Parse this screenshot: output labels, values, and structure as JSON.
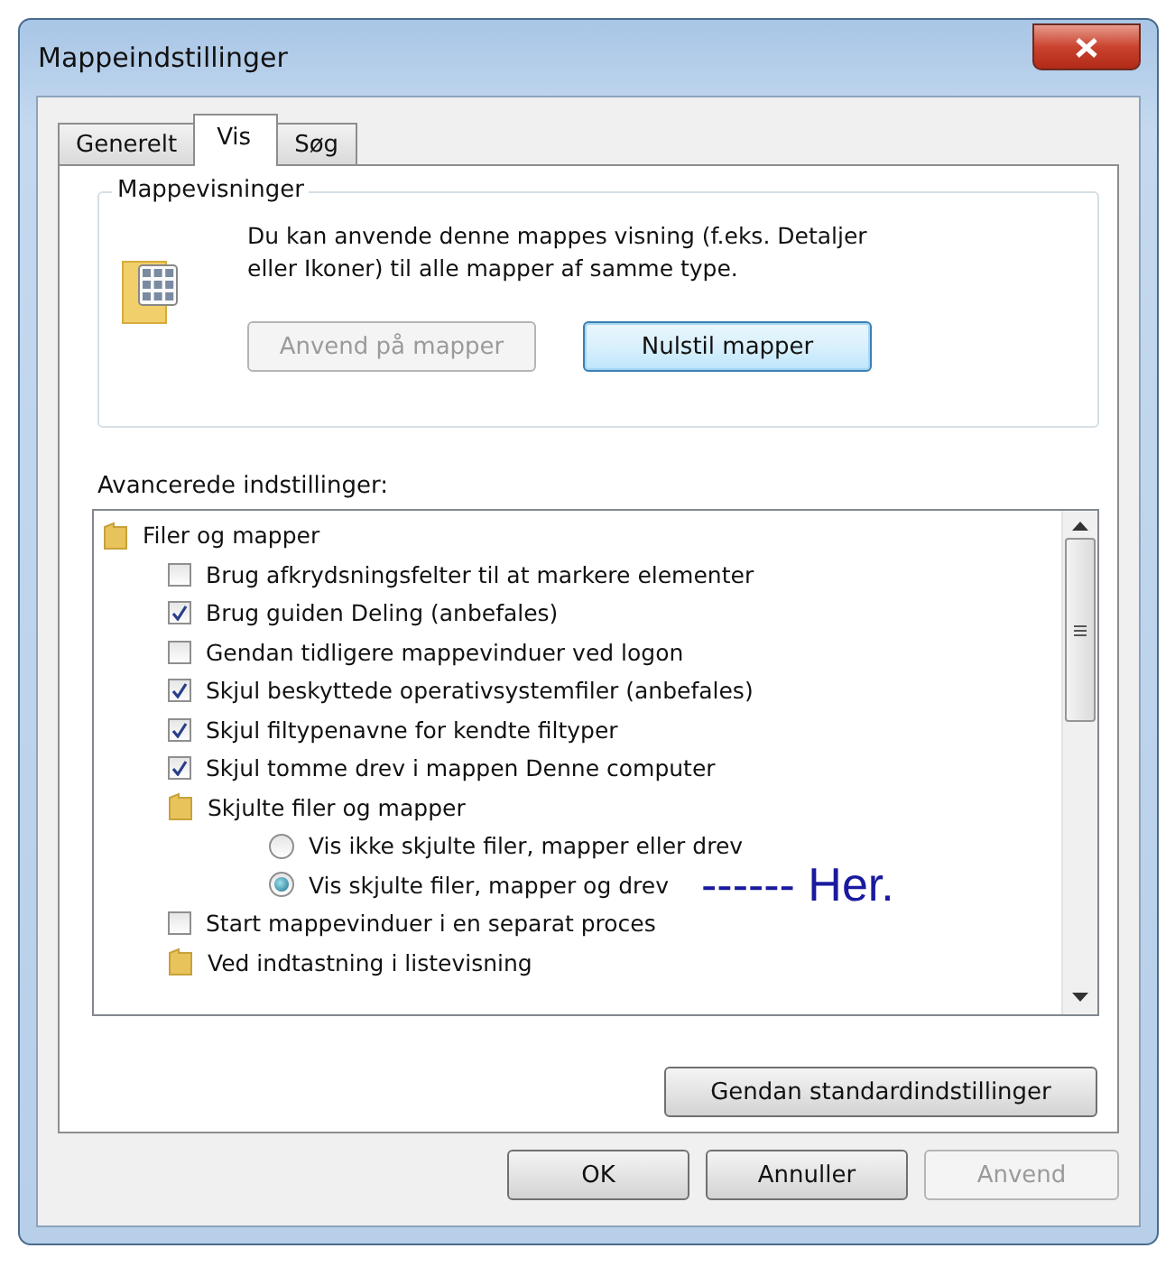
{
  "window": {
    "title": "Mappeindstillinger"
  },
  "tabs": [
    {
      "label": "Generelt",
      "selected": false
    },
    {
      "label": "Vis",
      "selected": true
    },
    {
      "label": "Søg",
      "selected": false
    }
  ],
  "folder_views": {
    "title": "Mappevisninger",
    "description": "Du kan anvende denne mappes visning (f.eks. Detaljer eller Ikoner) til alle mapper af samme type.",
    "buttons": [
      {
        "label": "Anvend på mapper",
        "disabled": true,
        "default": false
      },
      {
        "label": "Nulstil mapper",
        "disabled": false,
        "default": true
      }
    ]
  },
  "advanced": {
    "label": "Avancerede indstillinger:",
    "items": [
      {
        "kind": "folder",
        "label": "Filer og mapper",
        "children": [
          {
            "kind": "checkbox",
            "label": "Brug afkrydsningsfelter til at markere elementer",
            "checked": false
          },
          {
            "kind": "checkbox",
            "label": "Brug guiden Deling (anbefales)",
            "checked": true
          },
          {
            "kind": "checkbox",
            "label": "Gendan tidligere mappevinduer ved logon",
            "checked": false
          },
          {
            "kind": "checkbox",
            "label": "Skjul beskyttede operativsystemfiler (anbefales)",
            "checked": true
          },
          {
            "kind": "checkbox",
            "label": "Skjul filtypenavne for kendte filtyper",
            "checked": true
          },
          {
            "kind": "checkbox",
            "label": "Skjul tomme drev i mappen Denne computer",
            "checked": true
          },
          {
            "kind": "folder",
            "label": "Skjulte filer og mapper",
            "children": [
              {
                "kind": "radio",
                "label": "Vis ikke skjulte filer, mapper eller drev",
                "selected": false
              },
              {
                "kind": "radio",
                "label": "Vis skjulte filer, mapper og drev",
                "selected": true,
                "annotation": "------ Her."
              }
            ]
          },
          {
            "kind": "checkbox",
            "label": "Start mappevinduer i en separat proces",
            "checked": false
          },
          {
            "kind": "folder",
            "label": "Ved indtastning i listevisning"
          }
        ]
      }
    ]
  },
  "restore_button": {
    "label": "Gendan standardindstillinger"
  },
  "buttons": [
    {
      "label": "OK",
      "disabled": false
    },
    {
      "label": "Annuller",
      "disabled": false
    },
    {
      "label": "Anvend",
      "disabled": true
    }
  ]
}
